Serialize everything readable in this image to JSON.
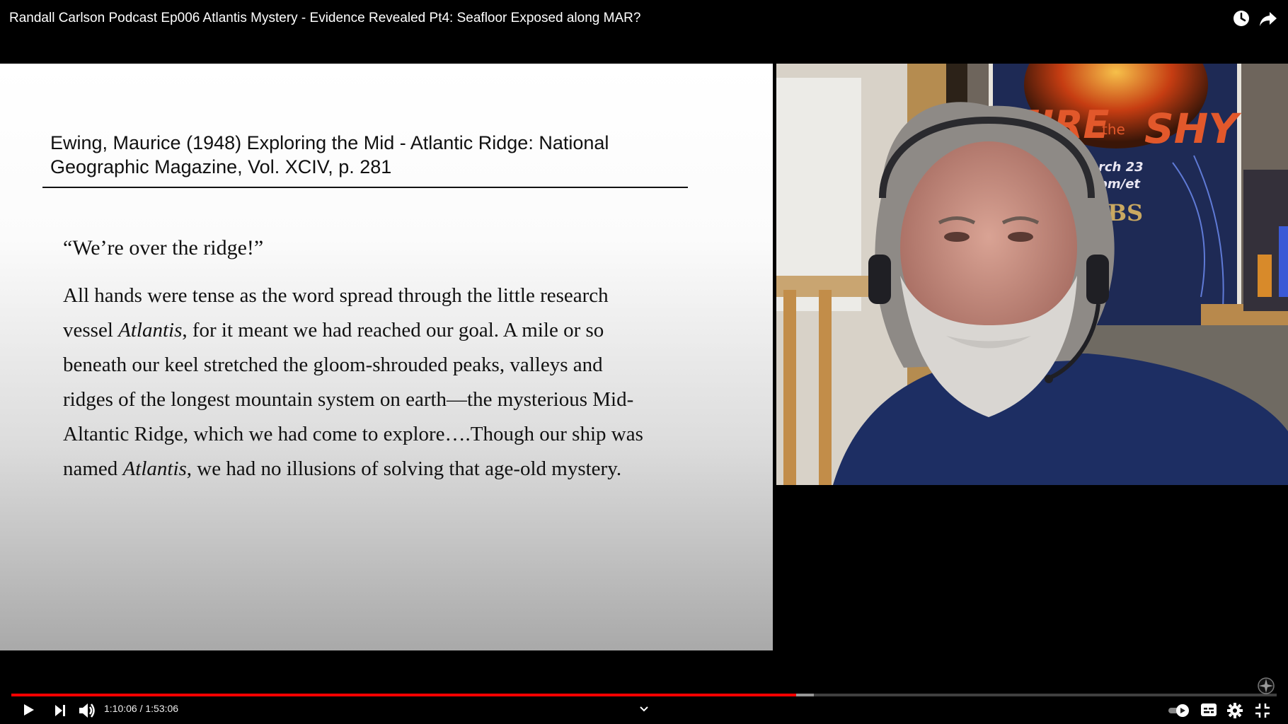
{
  "video": {
    "title": "Randall Carlson Podcast Ep006 Atlantis Mystery - Evidence Revealed Pt4: Seafloor Exposed along MAR?",
    "icons": {
      "watch_later": "clock-icon",
      "share": "share-arrow-icon"
    }
  },
  "slide": {
    "citation_lines": [
      "Ewing, Maurice (1948) Exploring the Mid - Atlantic Ridge: National",
      "Geographic Magazine, Vol. XCIV, p. 281"
    ],
    "quote_heading": "“We’re over the ridge!”",
    "quote_lines": [
      [
        {
          "t": "All hands were tense as the word spread through the little research"
        }
      ],
      [
        {
          "t": "vessel "
        },
        {
          "t": "Atlantis",
          "i": true
        },
        {
          "t": ", for it meant we had reached our goal. A mile or so"
        }
      ],
      [
        {
          "t": "beneath our keel stretched the gloom-shrouded peaks, valleys and"
        }
      ],
      [
        {
          "t": "ridges of the longest mountain system on earth—the mysterious Mid-"
        }
      ],
      [
        {
          "t": "Altantic Ridge, which we had come to explore….Though our ship was"
        }
      ],
      [
        {
          "t": "named "
        },
        {
          "t": "Atlantis",
          "i": true
        },
        {
          "t": ", we had no illusions of solving that age-old mystery."
        }
      ]
    ]
  },
  "webcam": {
    "poster_text": [
      "FIRE",
      "the",
      "SHY",
      "rch 23",
      "pm/et",
      "BS"
    ]
  },
  "player": {
    "current_time": "1:10:06",
    "duration": "1:53:06",
    "time_display": "1:10:06 / 1:53:06",
    "progress_fraction": 0.62,
    "buffered_fraction": 0.634,
    "accent_color": "#ff0000",
    "icons": [
      "play-icon",
      "next-icon",
      "volume-icon",
      "chapter-chevron-icon",
      "autoplay-toggle-icon",
      "subtitles-icon",
      "settings-icon",
      "exit-fullscreen-icon",
      "compass-icon"
    ]
  }
}
